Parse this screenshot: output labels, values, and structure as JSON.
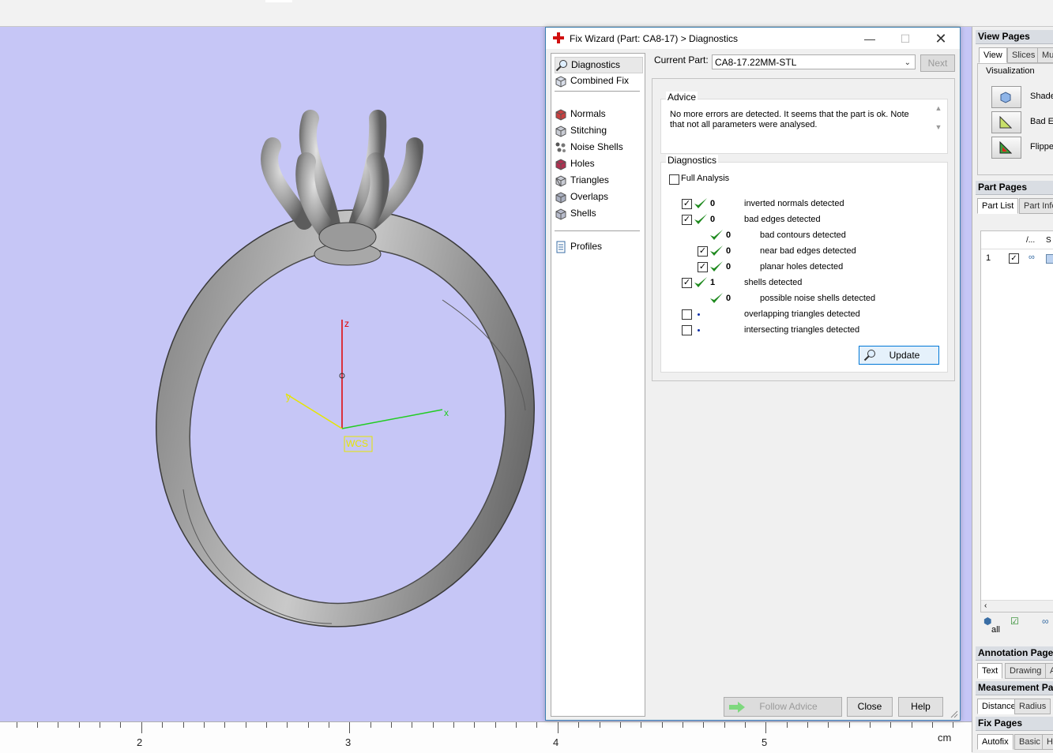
{
  "viewport": {
    "axis_labels": {
      "z": "z",
      "x": "x",
      "y": "y"
    },
    "wcs_label": "WCS"
  },
  "ruler": {
    "ticks": [
      "2",
      "3",
      "4",
      "5"
    ],
    "unit": "cm"
  },
  "dialog": {
    "title": "Fix Wizard (Part: CA8-17) > Diagnostics",
    "nav_items": [
      {
        "label": "Diagnostics",
        "icon": "magnifier-icon"
      },
      {
        "label": "Combined Fix",
        "icon": "combined-fix-icon"
      },
      {
        "label": "Normals",
        "icon": "normals-cube-icon"
      },
      {
        "label": "Stitching",
        "icon": "stitching-cube-icon"
      },
      {
        "label": "Noise Shells",
        "icon": "noise-shells-icon"
      },
      {
        "label": "Holes",
        "icon": "holes-cube-icon"
      },
      {
        "label": "Triangles",
        "icon": "triangles-cube-icon"
      },
      {
        "label": "Overlaps",
        "icon": "overlaps-cube-icon"
      },
      {
        "label": "Shells",
        "icon": "shells-cube-icon"
      },
      {
        "label": "Profiles",
        "icon": "profiles-page-icon"
      }
    ],
    "current_part_label": "Current Part:",
    "current_part_value": "CA8-17.22MM-STL",
    "next_button": "Next",
    "advice": {
      "title": "Advice",
      "text": "No more errors are detected. It seems that the part is ok. Note that not all parameters were analysed."
    },
    "diagnostics": {
      "title": "Diagnostics",
      "full_analysis_label": "Full Analysis",
      "full_analysis_checked": false,
      "rows": [
        {
          "checked": true,
          "status": "ok",
          "count": "0",
          "label": "inverted normals detected"
        },
        {
          "checked": true,
          "status": "ok",
          "count": "0",
          "label": "bad edges detected"
        },
        {
          "checked": null,
          "status": "ok",
          "count": "0",
          "label": "bad contours detected"
        },
        {
          "checked": true,
          "status": "ok",
          "count": "0",
          "label": "near bad edges detected"
        },
        {
          "checked": true,
          "status": "ok",
          "count": "0",
          "label": "planar holes detected"
        },
        {
          "checked": true,
          "status": "ok",
          "count": "1",
          "label": "shells detected"
        },
        {
          "checked": null,
          "status": "ok",
          "count": "0",
          "label": "possible noise shells detected"
        },
        {
          "checked": false,
          "status": "none",
          "count": "",
          "label": "overlapping triangles detected"
        },
        {
          "checked": false,
          "status": "none",
          "count": "",
          "label": "intersecting triangles detected"
        }
      ],
      "update_button": "Update"
    },
    "footer": {
      "follow_advice": "Follow Advice",
      "close": "Close",
      "help": "Help"
    }
  },
  "right_panel": {
    "view_pages": {
      "title": "View Pages",
      "tabs": [
        "View",
        "Slices",
        "Mul"
      ],
      "visualization_title": "Visualization",
      "buttons": [
        {
          "label": "Shade&",
          "icon": "shade-cube-icon"
        },
        {
          "label": "Bad Edg",
          "icon": "bad-edges-icon"
        },
        {
          "label": "Flipped",
          "icon": "flipped-triangles-icon"
        }
      ]
    },
    "part_pages": {
      "title": "Part Pages",
      "tabs": [
        "Part List",
        "Part Info"
      ],
      "columns": [
        "/...",
        "S"
      ],
      "rows": [
        {
          "index": "1",
          "checked": true
        }
      ],
      "footer_all": "all"
    },
    "annotation_pages": {
      "title": "Annotation Page",
      "tabs": [
        "Text",
        "Drawing",
        "A"
      ]
    },
    "measurement_pages": {
      "title": "Measurement Pa",
      "tabs": [
        "Distance",
        "Radius"
      ]
    },
    "fix_pages": {
      "title": "Fix Pages",
      "tabs": [
        "Autofix",
        "Basic",
        "H"
      ]
    }
  }
}
